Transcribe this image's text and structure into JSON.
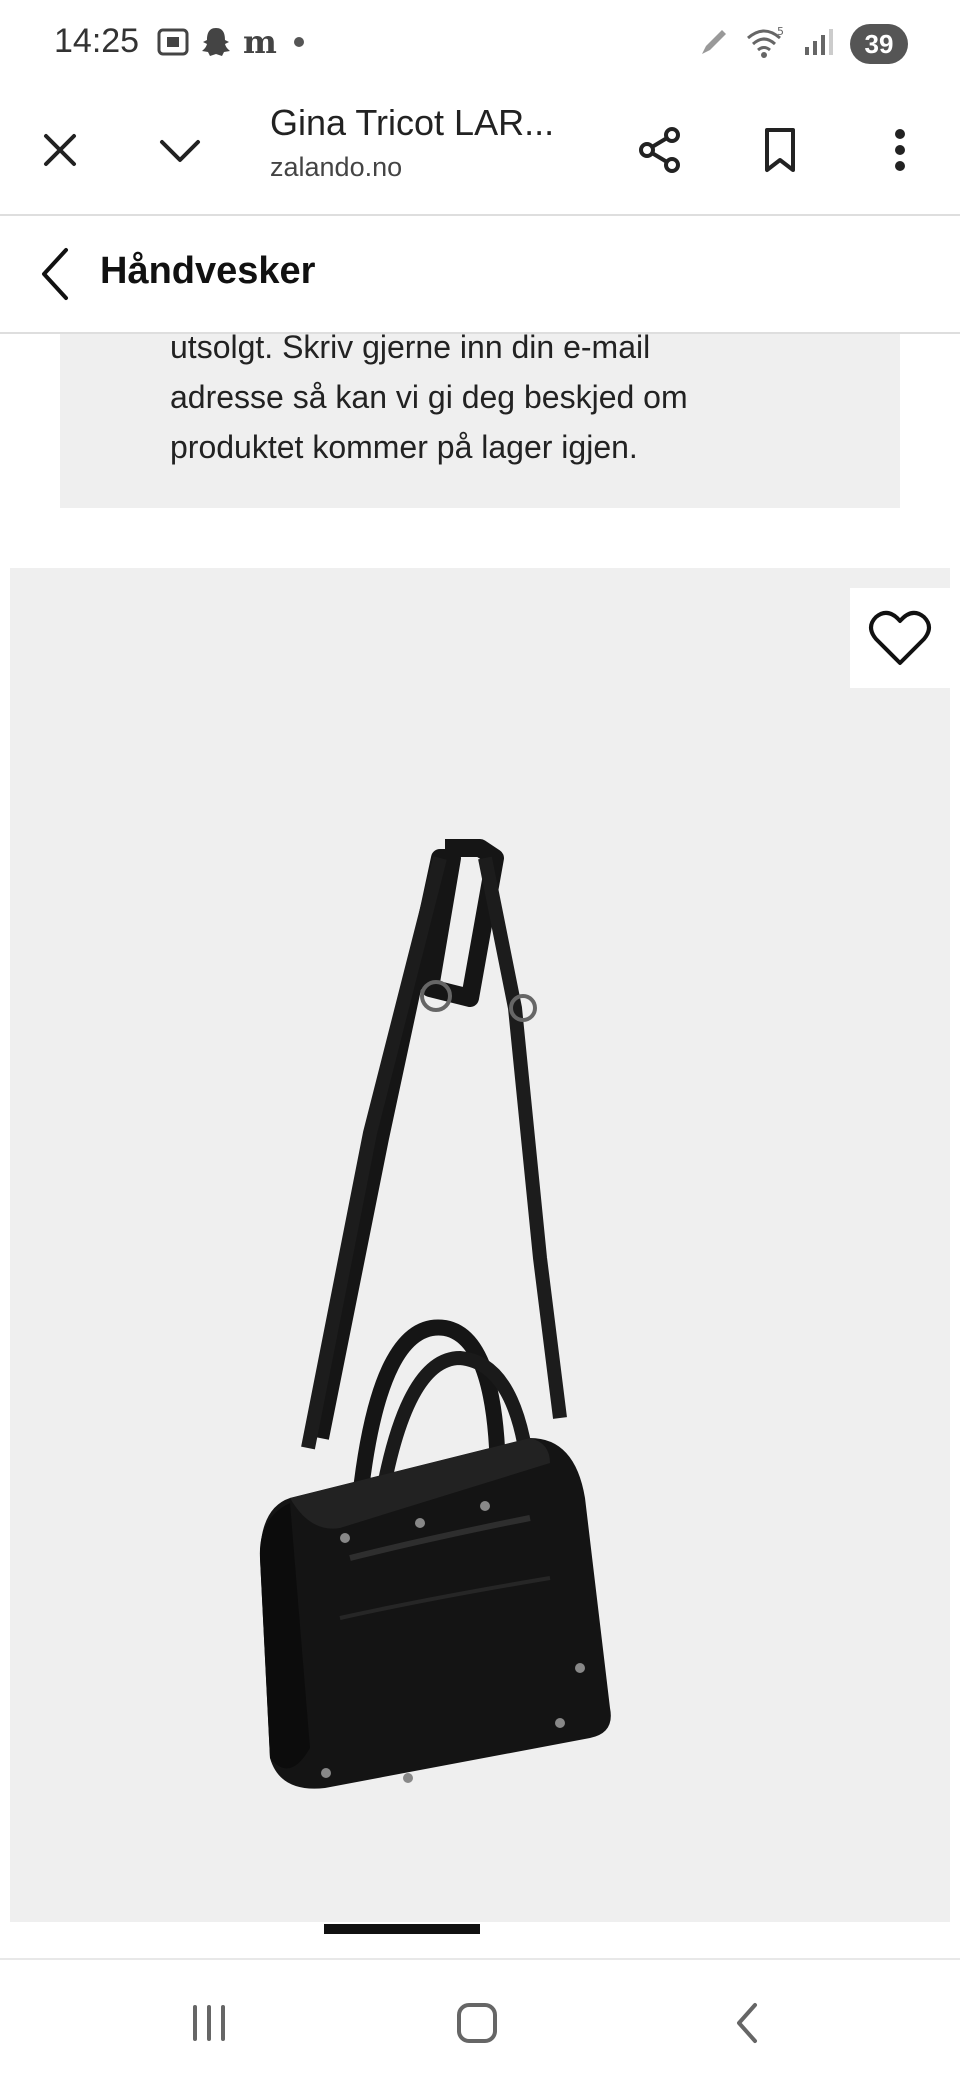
{
  "status_bar": {
    "time": "14:25",
    "left_icons": [
      "screenshot-icon",
      "snapchat-icon",
      "m-app-icon",
      "dot-icon"
    ],
    "right_icons": [
      "pen-icon",
      "wifi-5-icon",
      "signal-icon"
    ],
    "battery": "39"
  },
  "browser": {
    "tab_title": "Gina Tricot LAR...",
    "url": "zalando.no",
    "icons": [
      "close-icon",
      "chevron-down-icon",
      "share-icon",
      "bookmark-icon",
      "more-icon"
    ]
  },
  "category": {
    "title": "Håndvesker"
  },
  "notice": {
    "lines": [
      "utsolgt. Skriv gjerne inn din e-mail",
      "adresse så kan vi gi deg beskjed om",
      "produktet kommer på lager igjen."
    ]
  },
  "product": {
    "image_icon": "handbag-photo",
    "wishlist_icon": "heart-outline-icon"
  },
  "nav_bar": {
    "icons": [
      "recent-apps-icon",
      "home-icon",
      "back-icon"
    ]
  },
  "colors": {
    "background": "#ffffff",
    "panel_gray": "#efefef",
    "text": "#1a1a1a",
    "bag": "#141414"
  }
}
